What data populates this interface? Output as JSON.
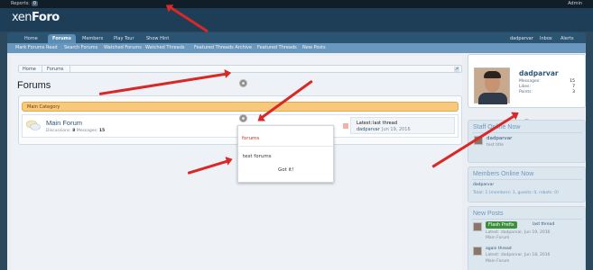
{
  "admin_bar": {
    "reports_label": "Reports:",
    "reports_count": "0",
    "admin_link": "Admin"
  },
  "logo": {
    "part1": "xen",
    "part2": "Foro"
  },
  "nav_tabs": [
    "Home",
    "Forums",
    "Members",
    "Play Tour",
    "Show Hint"
  ],
  "selected_tab": "Forums",
  "account_links": {
    "user": "dadparvar",
    "inbox": "Inbox",
    "alerts": "Alerts"
  },
  "sub_nav": [
    "Mark Forums Read",
    "Search Forums",
    "Watched Forums",
    "Watched Threads",
    "Featured Threads Archive",
    "Featured Threads",
    "New Posts"
  ],
  "breadcrumb": [
    "Home",
    "Forums"
  ],
  "page_title": "Forums",
  "category": {
    "title": "Main Category",
    "forum": {
      "name": "Main Forum",
      "discussions_label": "Discussions:",
      "discussions": "8",
      "messages_label": "Messages:",
      "messages": "15",
      "last_post": {
        "label": "Latest:",
        "thread": "last thread",
        "user": "dadparvar",
        "date": "Jun 19, 2016"
      }
    }
  },
  "hint_popup": {
    "highlight": "forums",
    "text": "test forums",
    "button": "Got it!"
  },
  "profile": {
    "username": "dadparvar",
    "stats": [
      {
        "label": "Messages:",
        "value": "15"
      },
      {
        "label": "Likes:",
        "value": "7"
      },
      {
        "label": "Points:",
        "value": "3"
      }
    ]
  },
  "staff_online": {
    "title": "Staff Online Now",
    "user": "dadparvar",
    "role": "test title"
  },
  "members_online": {
    "title": "Members Online Now",
    "user": "dadparvar",
    "totals": "Total: 1 (members: 1, guests: 0, robots: 0)"
  },
  "new_posts": {
    "title": "New Posts",
    "items": [
      {
        "prefix": "Flash Prefix",
        "title": "last thread",
        "meta": "Latest: dadparvar, Jun 19, 2016",
        "forum": "Main Forum"
      },
      {
        "prefix": "",
        "title": "again thread",
        "meta": "Latest: dadparvar, Jun 18, 2016",
        "forum": "Main Forum"
      }
    ]
  },
  "colors": {
    "arrow": "#d92828",
    "accent": "#2c5576",
    "category_header": "#f6c97d",
    "nav_selected": "#5c8db5"
  }
}
